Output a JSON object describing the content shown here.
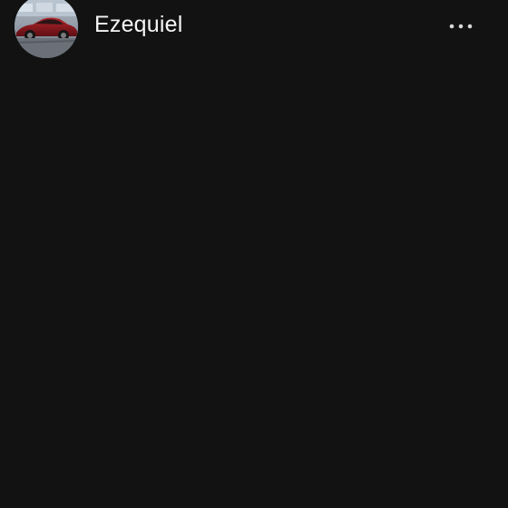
{
  "profile": {
    "username": "Ezequiel",
    "avatar_icon": "car-photo-avatar"
  },
  "header": {
    "more_icon": "more-horizontal-icon"
  },
  "colors": {
    "background": "#121212",
    "text": "#f5f5f5",
    "icon": "#d8d8d8",
    "avatar_car": "#8b1a1f"
  }
}
